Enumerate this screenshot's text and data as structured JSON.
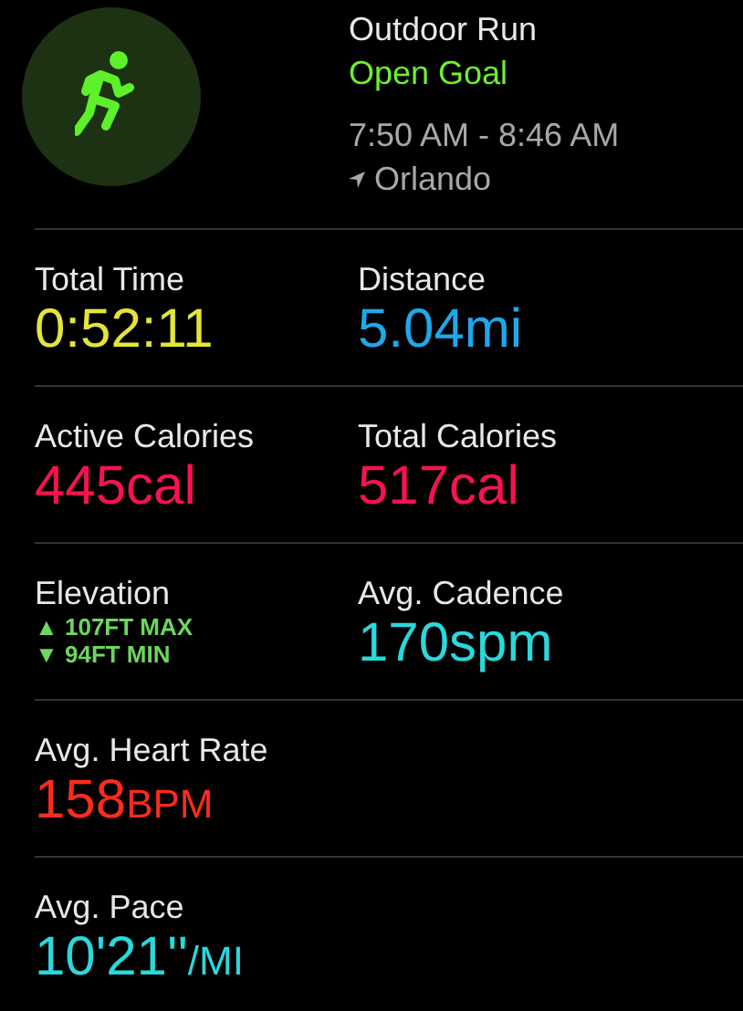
{
  "header": {
    "title": "Outdoor Run",
    "goal": "Open Goal",
    "time": "7:50 AM - 8:46 AM",
    "location": "Orlando"
  },
  "rows": [
    {
      "cells": [
        {
          "kind": "value",
          "label": "Total Time",
          "value": "0:52:11",
          "color": "#e3e53a"
        },
        {
          "kind": "value",
          "label": "Distance",
          "value": "5.04mi",
          "color": "#1ea8ec"
        }
      ]
    },
    {
      "cells": [
        {
          "kind": "value",
          "label": "Active Calories",
          "value": "445cal",
          "color": "#f9124f"
        },
        {
          "kind": "value",
          "label": "Total Calories",
          "value": "517cal",
          "color": "#f9124f"
        }
      ]
    },
    {
      "cells": [
        {
          "kind": "elevation",
          "label": "Elevation",
          "max": "▲ 107FT MAX",
          "min": "▼ 94FT MIN",
          "color": "#6cd65e"
        },
        {
          "kind": "value",
          "label": "Avg. Cadence",
          "value": "170spm",
          "color": "#2ad8dc"
        }
      ]
    },
    {
      "cells": [
        {
          "kind": "value",
          "label": "Avg. Heart Rate",
          "value": "158",
          "unit": "BPM",
          "color": "#ff2b1c"
        }
      ]
    },
    {
      "cells": [
        {
          "kind": "value",
          "label": "Avg. Pace",
          "value": "10'21''",
          "unit": "/MI",
          "color": "#2ad8dc"
        }
      ]
    }
  ]
}
